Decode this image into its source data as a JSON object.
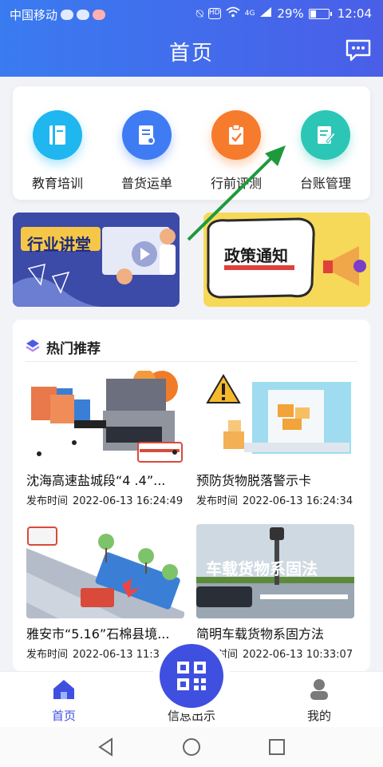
{
  "status_bar": {
    "carrier": "中国移动",
    "battery": "29%",
    "time": "12:04",
    "network": "4G",
    "hd": "HD"
  },
  "header": {
    "title": "首页"
  },
  "quick_menu": [
    {
      "label": "教育培训",
      "icon": "book-icon",
      "color": "#20b6f0"
    },
    {
      "label": "普货运单",
      "icon": "waybill-icon",
      "color": "#3f7cf4"
    },
    {
      "label": "行前评测",
      "icon": "clipboard-icon",
      "color": "#f77b2c"
    },
    {
      "label": "台账管理",
      "icon": "ledger-edit-icon",
      "color": "#2cc6b6"
    }
  ],
  "banners": {
    "left": {
      "text": "行业讲堂"
    },
    "right": {
      "text": "政策通知"
    }
  },
  "hot": {
    "title": "热门推荐",
    "items": [
      {
        "title": "沈海高速盐城段“4 .4”...",
        "time_label": "发布时间",
        "time": "2022-06-13 16:24:49"
      },
      {
        "title": "预防货物脱落警示卡",
        "time_label": "发布时间",
        "time": "2022-06-13 16:24:34"
      },
      {
        "title": "雅安市“5.16”石棉县境...",
        "time_label": "发布时间",
        "time": "2022-06-13 11:3"
      },
      {
        "title": "简明车载货物系固方法",
        "time_label": "发布时间",
        "time": "2022-06-13 10:33:07",
        "thumb_text": "车载货物系固法"
      }
    ]
  },
  "bottom_nav": [
    {
      "label": "首页",
      "active": true
    },
    {
      "label": "信息出示",
      "active": false
    },
    {
      "label": "我的",
      "active": false
    }
  ],
  "colors": {
    "accent": "#3f4fe0",
    "header_start": "#3a7bf0",
    "header_end": "#4a5ee8",
    "arrow": "#1e9a3c"
  }
}
